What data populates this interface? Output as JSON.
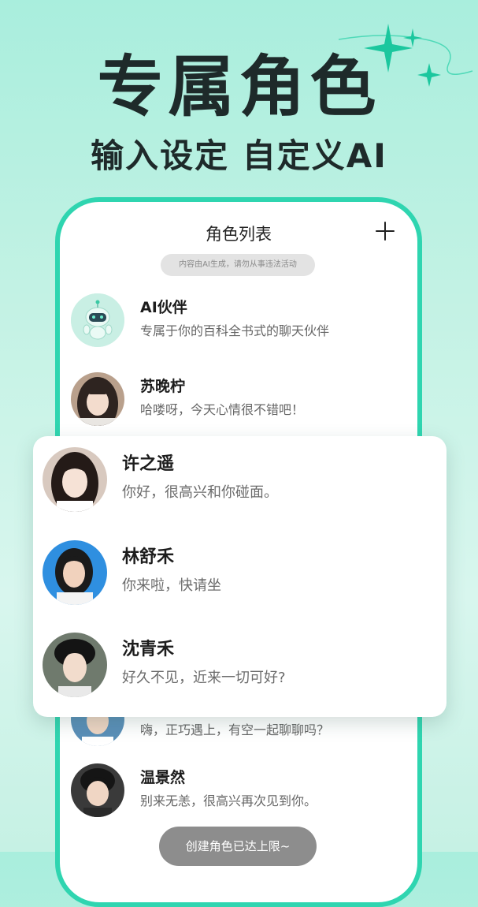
{
  "promo": {
    "headline": "专属角色",
    "subline": "输入设定 自定义AI"
  },
  "screen": {
    "title": "角色列表",
    "notice": "内容由AI生成，请勿从事违法活动",
    "items": [
      {
        "name": "AI伙伴",
        "message": "专属于你的百科全书式的聊天伙伴",
        "avatar": "robot-icon"
      },
      {
        "name": "苏晚柠",
        "message": "哈喽呀，今天心情很不错吧！",
        "avatar": "portrait-photo"
      },
      {
        "name": "",
        "message": "嗨，正巧遇上，有空一起聊聊吗？",
        "avatar": "portrait-photo"
      },
      {
        "name": "温景然",
        "message": "别来无恙，很高兴再次见到你。",
        "avatar": "portrait-photo"
      }
    ],
    "limit_label": "创建角色已达上限~"
  },
  "featured": {
    "items": [
      {
        "name": "许之遥",
        "message": "你好，很高兴和你碰面。",
        "avatar": "portrait-photo"
      },
      {
        "name": "林舒禾",
        "message": "你来啦，快请坐",
        "avatar": "portrait-photo"
      },
      {
        "name": "沈青禾",
        "message": "好久不见，近来一切可好?",
        "avatar": "portrait-photo"
      }
    ]
  },
  "colors": {
    "accent": "#2fd5b0",
    "background_top": "#a9eedd",
    "text_dark": "#1e2a2a"
  }
}
